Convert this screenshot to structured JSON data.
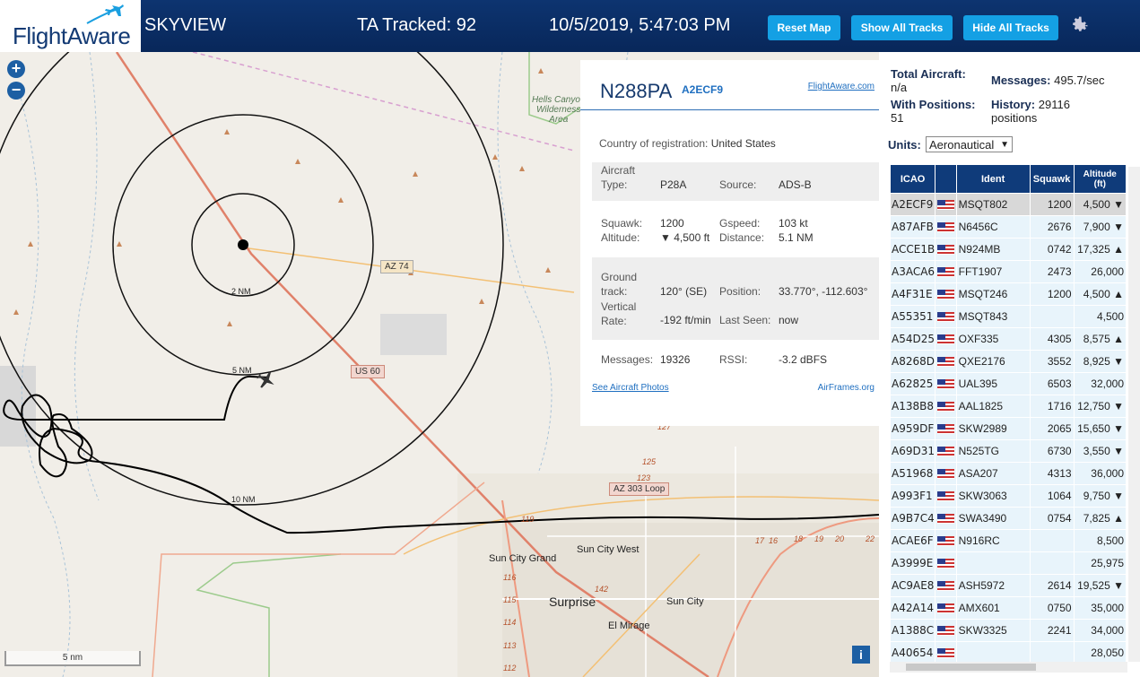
{
  "header": {
    "logo_text": "FlightAware",
    "app_title": "SKYVIEW",
    "tracked": "TA Tracked: 92",
    "datetime": "10/5/2019, 5:47:03 PM",
    "buttons": {
      "reset": "Reset Map",
      "show": "Show All Tracks",
      "hide": "Hide All Tracks"
    },
    "settings_icon": "gear-icon"
  },
  "map": {
    "zoom_in": "+",
    "zoom_out": "−",
    "scale": "5 nm",
    "info": "i",
    "labels": {
      "wilderness": "Hells Canyon\nWilderness\nArea",
      "ring_2": "2 NM",
      "ring_5": "5 NM",
      "ring_10": "10 NM",
      "az74": "AZ 74",
      "us60": "US 60",
      "az303": "AZ 303 Loop",
      "sun_city_west": "Sun City West",
      "sun_city_grand": "Sun City Grand",
      "surprise": "Surprise",
      "sun_city": "Sun City",
      "el_mirage": "El Mirage",
      "route_127": "127",
      "route_125": "125",
      "route_123": "123",
      "route_119": "119",
      "route_116": "116",
      "route_115": "115",
      "route_114": "114",
      "route_113": "113",
      "route_112": "112",
      "route_142": "142",
      "route_17": "17",
      "route_16": "16",
      "route_18": "18",
      "route_19": "19",
      "route_20": "20",
      "route_22": "22"
    }
  },
  "popup": {
    "registration": "N288PA",
    "hex": "A2ECF9",
    "fa_link": "FlightAware.com",
    "country_label": "Country of registration:",
    "country": "United States",
    "aircraft_type_label": "Aircraft\nType:",
    "aircraft_type": "P28A",
    "source_label": "Source:",
    "source": "ADS-B",
    "squawk_label": "Squawk:",
    "squawk": "1200",
    "altitude_label": "Altitude:",
    "altitude": "▼ 4,500 ft",
    "gspeed_label": "Gspeed:",
    "gspeed": "103 kt",
    "distance_label": "Distance:",
    "distance": "5.1 NM",
    "track_label": "Ground\ntrack:",
    "track": "120° (SE)",
    "position_label": "Position:",
    "position": "33.770°, -112.603°",
    "vrate_label": "Vertical\nRate:",
    "vrate": "-192 ft/min",
    "lastseen_label": "Last Seen:",
    "lastseen": "now",
    "messages_label": "Messages:",
    "messages": "19326",
    "rssi_label": "RSSI:",
    "rssi": "-3.2 dBFS",
    "photos_link": "See Aircraft Photos",
    "airframes_link": "AirFrames.org"
  },
  "stats": {
    "total_label": "Total Aircraft:",
    "total": "n/a",
    "messages_label": "Messages:",
    "messages": "495.7/sec",
    "positions_label": "With Positions:",
    "positions": "51",
    "history_label": "History:",
    "history": "29116",
    "history_unit": "positions",
    "units_label": "Units:",
    "units": "Aeronautical"
  },
  "table": {
    "headers": [
      "ICAO",
      "",
      "Ident",
      "Squawk",
      "Altitude\n(ft)"
    ],
    "rows": [
      {
        "icao": "A2ECF9",
        "ident": "MSQT802",
        "squawk": "1200",
        "alt": "4,500 ▼"
      },
      {
        "icao": "A87AFB",
        "ident": "N6456C",
        "squawk": "2676",
        "alt": "7,900 ▼"
      },
      {
        "icao": "ACCE1B",
        "ident": "N924MB",
        "squawk": "0742",
        "alt": "17,325 ▲"
      },
      {
        "icao": "A3ACA6",
        "ident": "FFT1907",
        "squawk": "2473",
        "alt": "26,000"
      },
      {
        "icao": "A4F31E",
        "ident": "MSQT246",
        "squawk": "1200",
        "alt": "4,500 ▲"
      },
      {
        "icao": "A55351",
        "ident": "MSQT843",
        "squawk": "",
        "alt": "4,500"
      },
      {
        "icao": "A54D25",
        "ident": "OXF335",
        "squawk": "4305",
        "alt": "8,575 ▲"
      },
      {
        "icao": "A8268D",
        "ident": "QXE2176",
        "squawk": "3552",
        "alt": "8,925 ▼"
      },
      {
        "icao": "A62825",
        "ident": "UAL395",
        "squawk": "6503",
        "alt": "32,000"
      },
      {
        "icao": "A138B8",
        "ident": "AAL1825",
        "squawk": "1716",
        "alt": "12,750 ▼"
      },
      {
        "icao": "A959DF",
        "ident": "SKW2989",
        "squawk": "2065",
        "alt": "15,650 ▼"
      },
      {
        "icao": "A69D31",
        "ident": "N525TG",
        "squawk": "6730",
        "alt": "3,550 ▼"
      },
      {
        "icao": "A51968",
        "ident": "ASA207",
        "squawk": "4313",
        "alt": "36,000"
      },
      {
        "icao": "A993F1",
        "ident": "SKW3063",
        "squawk": "1064",
        "alt": "9,750 ▼"
      },
      {
        "icao": "A9B7C4",
        "ident": "SWA3490",
        "squawk": "0754",
        "alt": "7,825 ▲"
      },
      {
        "icao": "ACAE6F",
        "ident": "N916RC",
        "squawk": "",
        "alt": "8,500"
      },
      {
        "icao": "A3999E",
        "ident": "",
        "squawk": "",
        "alt": "25,975"
      },
      {
        "icao": "AC9AE8",
        "ident": "ASH5972",
        "squawk": "2614",
        "alt": "19,525 ▼"
      },
      {
        "icao": "A42A14",
        "ident": "AMX601",
        "squawk": "0750",
        "alt": "35,000"
      },
      {
        "icao": "A1388C",
        "ident": "SKW3325",
        "squawk": "2241",
        "alt": "34,000"
      },
      {
        "icao": "A40654",
        "ident": "",
        "squawk": "",
        "alt": "28,050"
      }
    ]
  }
}
